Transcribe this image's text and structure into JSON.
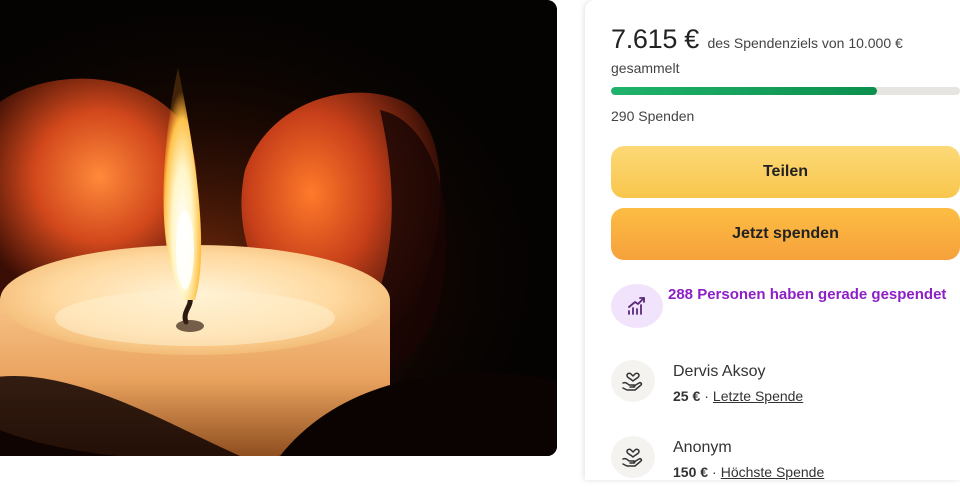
{
  "campaign": {
    "raised_amount": "7.615 €",
    "goal_text": "des Spendenziels von 10.000 €",
    "raised_suffix": "gesammelt",
    "progress_fraction": 0.7615,
    "donation_count": "290 Spenden"
  },
  "actions": {
    "share_label": "Teilen",
    "donate_label": "Jetzt spenden"
  },
  "trend": {
    "text": "288 Personen haben gerade gespendet",
    "icon": "trending-up-icon"
  },
  "donors": [
    {
      "name": "Dervis Aksoy",
      "amount": "25 €",
      "sep": "·",
      "tag": "Letzte Spende",
      "icon": "heart-hands-icon"
    },
    {
      "name": "Anonym",
      "amount": "150 €",
      "sep": "·",
      "tag": "Höchste Spende",
      "icon": "heart-hands-icon"
    }
  ],
  "colors": {
    "progress": "#0b8f4d",
    "share_button": "#f8c64c",
    "donate_button": "#f6a13b",
    "trend_text": "#8e1fc7",
    "trend_icon_bg": "#f1e3fb"
  }
}
